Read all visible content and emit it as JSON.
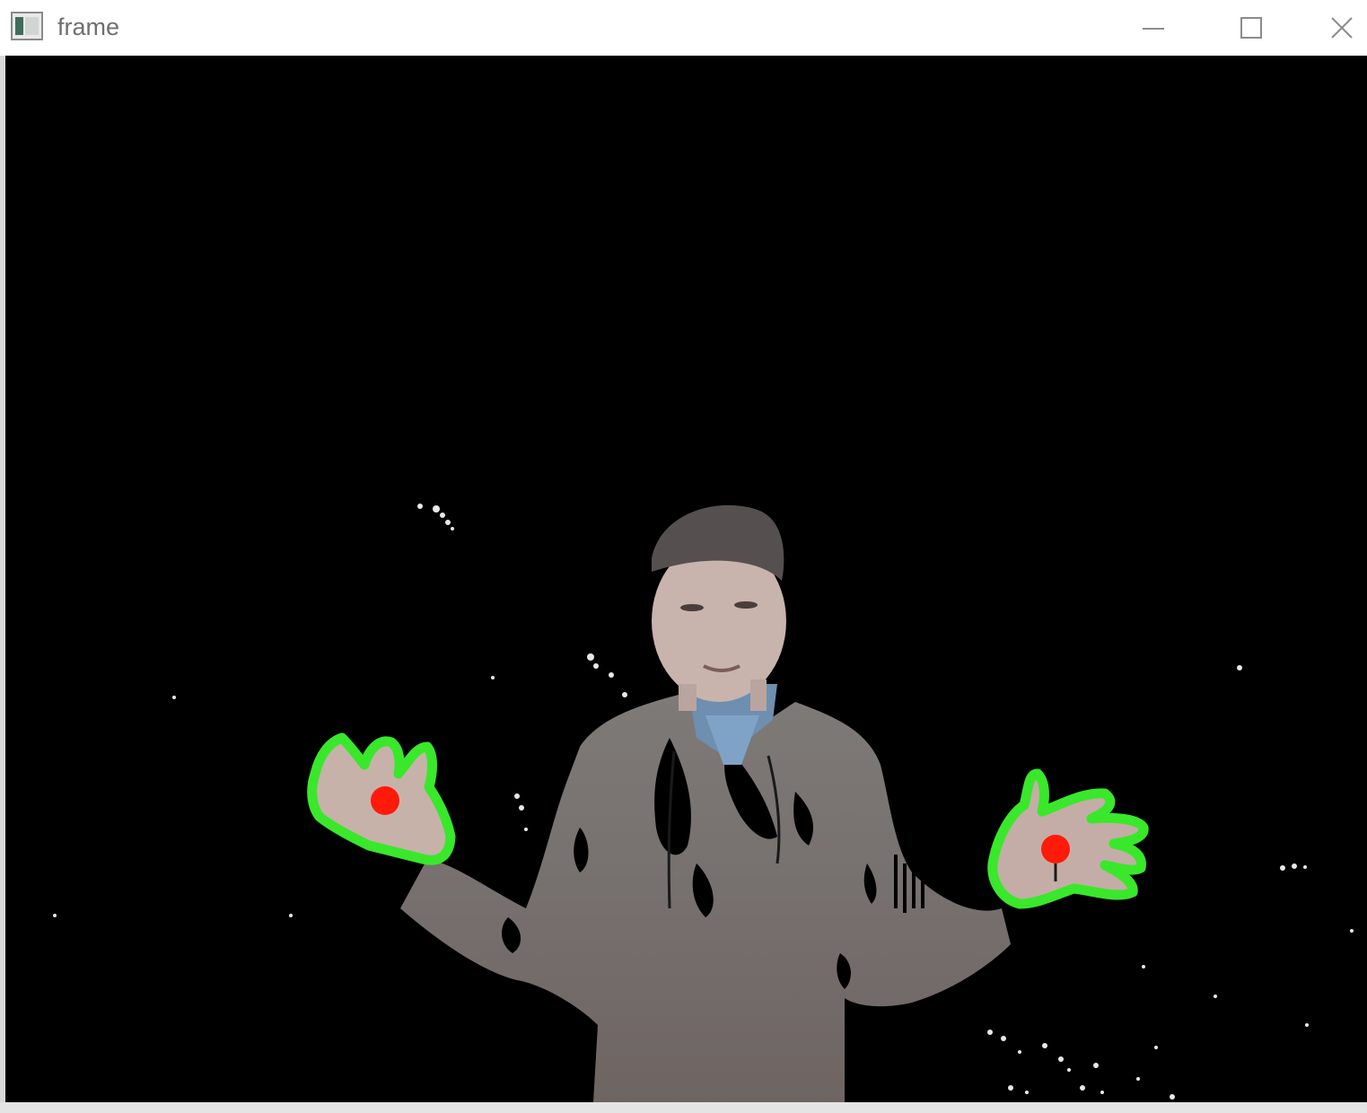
{
  "window": {
    "title": "frame",
    "icon": "opencv-window-icon",
    "controls": {
      "minimize": "minimize-icon",
      "maximize": "maximize-icon",
      "close": "close-icon"
    }
  },
  "scene": {
    "background": "#000000",
    "contour_color": "#39e82a",
    "centroid_color": "#ff1a0a",
    "detected_hands": 2
  }
}
